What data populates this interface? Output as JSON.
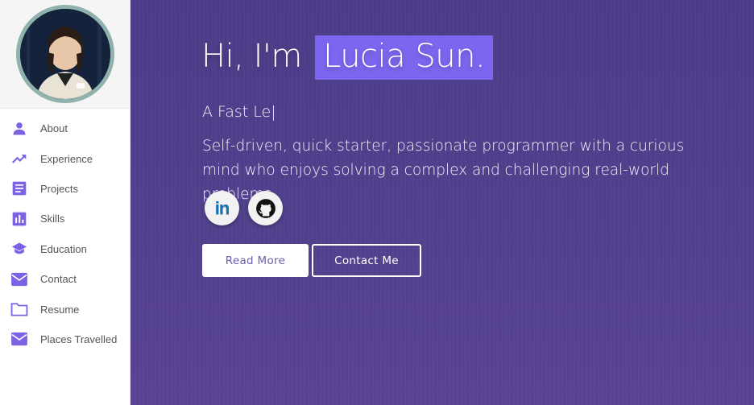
{
  "sidebar": {
    "icon_color": "#7c63e6",
    "items": [
      {
        "label": "About",
        "icon": "person-icon"
      },
      {
        "label": "Experience",
        "icon": "trending-up-icon"
      },
      {
        "label": "Projects",
        "icon": "article-icon"
      },
      {
        "label": "Skills",
        "icon": "bar-chart-icon"
      },
      {
        "label": "Education",
        "icon": "school-icon"
      },
      {
        "label": "Contact",
        "icon": "mail-icon"
      },
      {
        "label": "Resume",
        "icon": "folder-icon"
      },
      {
        "label": "Places Travelled",
        "icon": "mail-icon"
      }
    ]
  },
  "hero": {
    "greeting": "Hi, I'm",
    "name": "Lucia Sun.",
    "typed_text": "A Fast Le|",
    "tagline": "Self-driven, quick starter, passionate programmer with a curious mind who enjoys solving a complex and challenging real-world problems.",
    "highlight_color": "#7d66ef",
    "socials": [
      {
        "icon": "linkedin-icon",
        "text": "in"
      },
      {
        "icon": "github-icon"
      }
    ],
    "buttons": {
      "read_more": "Read More",
      "contact_me": "Contact Me"
    }
  }
}
